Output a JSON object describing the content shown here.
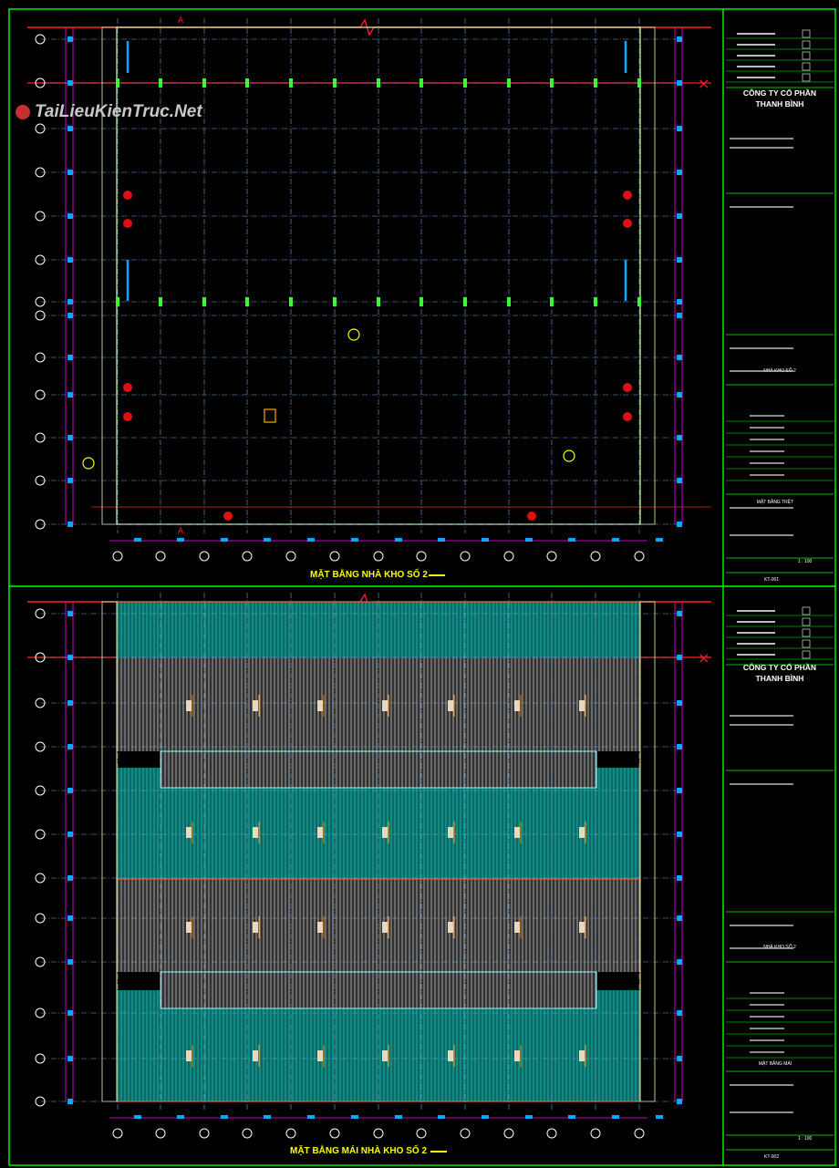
{
  "watermark": {
    "text": "TaiLieuKienTruc.Net"
  },
  "sheets": [
    {
      "plan_title": "MẶT BẰNG NHÀ KHO SỐ 2",
      "section_mark": "A",
      "company": [
        "CÔNG TY CỔ PHẦN",
        "THANH BÌNH"
      ],
      "project": "NHÀ KHO SỐ 2",
      "drawing_name": "MẶT BẰNG TRỆT",
      "sheet_no": "KT-001",
      "scale": "1 : 100"
    },
    {
      "plan_title": "MẶT BẰNG MÁI NHÀ KHO SỐ 2",
      "company": [
        "CÔNG TY CỔ PHẦN",
        "THANH BÌNH"
      ],
      "project": "NHÀ KHO SỐ 2",
      "drawing_name": "MẶT BẰNG MÁI",
      "sheet_no": "KT-002",
      "scale": "1 : 100"
    }
  ],
  "colors": {
    "border": "#00ff00",
    "grid": "#6fa8dc",
    "roof": "#0fa39a",
    "roof_light": "#b8b8b8",
    "dimension": "#ff00ff",
    "red_line": "#ff2020",
    "wall": "#d8ffb0",
    "window": "#00aaff"
  }
}
